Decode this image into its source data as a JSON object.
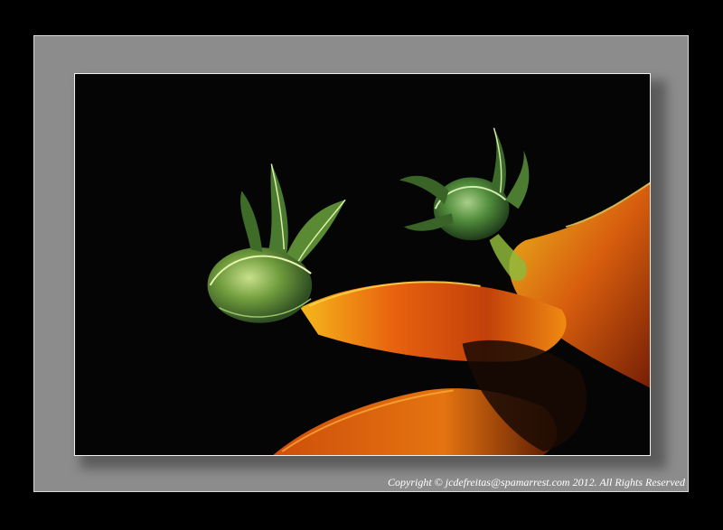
{
  "copyright": {
    "text": "Copyright © jcdefreitas@spamarrest.com 2012. All Rights Reserved"
  },
  "colors": {
    "background": "#000000",
    "mat": "#8c8c8c",
    "stem_orange": "#e8620f",
    "stem_yellow": "#f5b81a",
    "bud_green": "#4f8a3a",
    "bud_light": "#c8e08a"
  },
  "photo": {
    "subject": "two green flower buds on orange stems against black background"
  }
}
